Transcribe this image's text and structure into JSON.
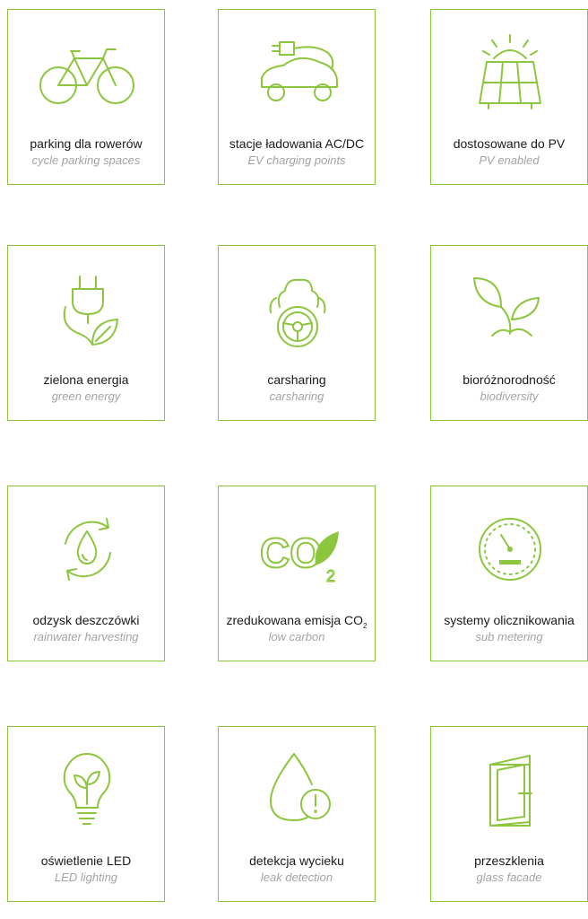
{
  "colors": {
    "accent": "#8cc63f",
    "text": "#1a1a1a",
    "subtext": "#a3a3a3"
  },
  "tiles": [
    {
      "icon": "bicycle-icon",
      "pl": "parking dla rowerów",
      "en": "cycle parking spaces"
    },
    {
      "icon": "ev-charging-car-icon",
      "pl": "stacje ładowania AC/DC",
      "en": "EV charging points"
    },
    {
      "icon": "solar-panel-icon",
      "pl": "dostosowane do PV",
      "en": "PV enabled"
    },
    {
      "icon": "plug-leaf-icon",
      "pl": "zielona energia",
      "en": "green energy"
    },
    {
      "icon": "carsharing-icon",
      "pl": "carsharing",
      "en": "carsharing"
    },
    {
      "icon": "sprout-icon",
      "pl": "bioróżnorodność",
      "en": "biodiversity"
    },
    {
      "icon": "water-recycle-icon",
      "pl": "odzysk deszczówki",
      "en": "rainwater harvesting"
    },
    {
      "icon": "co2-leaf-icon",
      "pl": "zredukowana emisja CO",
      "pl_sub": "2",
      "en": "low carbon"
    },
    {
      "icon": "meter-gauge-icon",
      "pl": "systemy olicznikowania",
      "en": "sub metering"
    },
    {
      "icon": "led-bulb-icon",
      "pl": "oświetlenie LED",
      "en": "LED lighting"
    },
    {
      "icon": "leak-drop-icon",
      "pl": "detekcja wycieku",
      "en": "leak detection"
    },
    {
      "icon": "door-icon",
      "pl": "przeszklenia",
      "en": "glass facade"
    }
  ]
}
